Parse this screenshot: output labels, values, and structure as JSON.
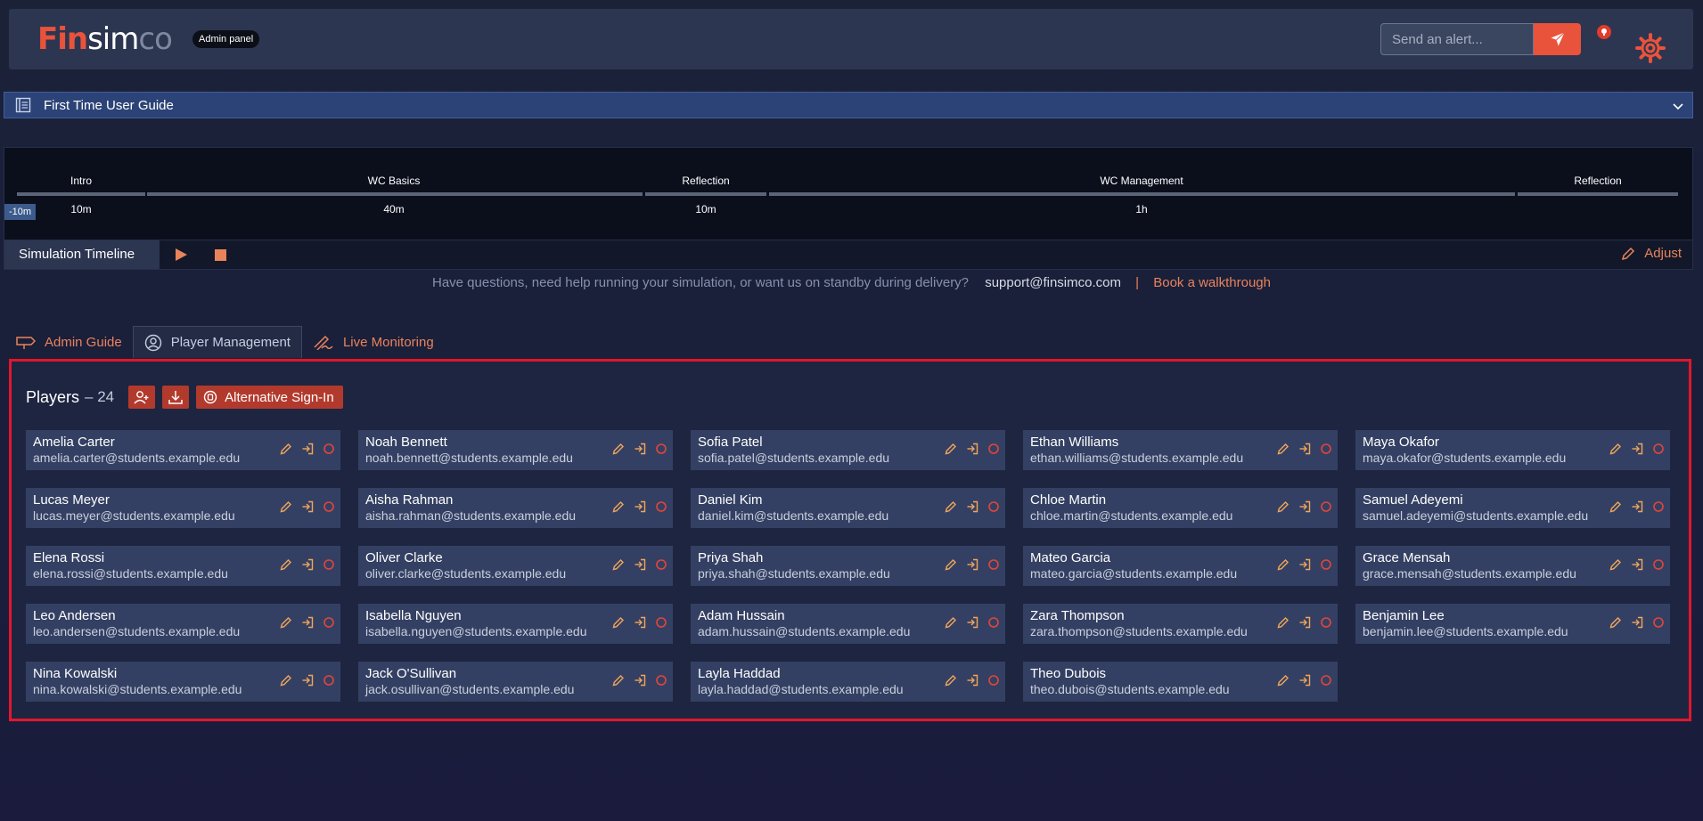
{
  "app": {
    "logo": {
      "fin": "Fin",
      "sim": "sim",
      "co": "co"
    },
    "badge": "Admin panel"
  },
  "alert": {
    "placeholder": "Send an alert..."
  },
  "guide": {
    "label": "First Time User Guide"
  },
  "timeline": {
    "offset": "-10m",
    "segments": [
      {
        "label": "Intro",
        "duration": "10m"
      },
      {
        "label": "WC Basics",
        "duration": "40m"
      },
      {
        "label": "Reflection",
        "duration": "10m"
      },
      {
        "label": "WC Management",
        "duration": "1h"
      },
      {
        "label": "Reflection",
        "duration": ""
      }
    ],
    "bar_label": "Simulation Timeline",
    "adjust_label": "Adjust"
  },
  "help": {
    "text": "Have questions, need help running your simulation, or want us on standby during delivery?",
    "email": "support@finsimco.com",
    "separator": "|",
    "walkthrough": "Book a walkthrough"
  },
  "tabs": [
    {
      "label": "Admin Guide",
      "icon": "signpost-icon",
      "active": false
    },
    {
      "label": "Player Management",
      "icon": "user-gear-icon",
      "active": true
    },
    {
      "label": "Live Monitoring",
      "icon": "signature-icon",
      "active": false
    }
  ],
  "players": {
    "title": "Players",
    "count": "– 24",
    "alt_signin": "Alternative Sign-In",
    "list": [
      {
        "name": "Amelia Carter",
        "email": "amelia.carter@students.example.edu"
      },
      {
        "name": "Noah Bennett",
        "email": "noah.bennett@students.example.edu"
      },
      {
        "name": "Sofia Patel",
        "email": "sofia.patel@students.example.edu"
      },
      {
        "name": "Ethan Williams",
        "email": "ethan.williams@students.example.edu"
      },
      {
        "name": "Maya Okafor",
        "email": "maya.okafor@students.example.edu"
      },
      {
        "name": "Lucas Meyer",
        "email": "lucas.meyer@students.example.edu"
      },
      {
        "name": "Aisha Rahman",
        "email": "aisha.rahman@students.example.edu"
      },
      {
        "name": "Daniel Kim",
        "email": "daniel.kim@students.example.edu"
      },
      {
        "name": "Chloe Martin",
        "email": "chloe.martin@students.example.edu"
      },
      {
        "name": "Samuel Adeyemi",
        "email": "samuel.adeyemi@students.example.edu"
      },
      {
        "name": "Elena Rossi",
        "email": "elena.rossi@students.example.edu"
      },
      {
        "name": "Oliver Clarke",
        "email": "oliver.clarke@students.example.edu"
      },
      {
        "name": "Priya Shah",
        "email": "priya.shah@students.example.edu"
      },
      {
        "name": "Mateo Garcia",
        "email": "mateo.garcia@students.example.edu"
      },
      {
        "name": "Grace Mensah",
        "email": "grace.mensah@students.example.edu"
      },
      {
        "name": "Leo Andersen",
        "email": "leo.andersen@students.example.edu"
      },
      {
        "name": "Isabella Nguyen",
        "email": "isabella.nguyen@students.example.edu"
      },
      {
        "name": "Adam Hussain",
        "email": "adam.hussain@students.example.edu"
      },
      {
        "name": "Zara Thompson",
        "email": "zara.thompson@students.example.edu"
      },
      {
        "name": "Benjamin Lee",
        "email": "benjamin.lee@students.example.edu"
      },
      {
        "name": "Nina Kowalski",
        "email": "nina.kowalski@students.example.edu"
      },
      {
        "name": "Jack O'Sullivan",
        "email": "jack.osullivan@students.example.edu"
      },
      {
        "name": "Layla Haddad",
        "email": "layla.haddad@students.example.edu"
      },
      {
        "name": "Theo Dubois",
        "email": "theo.dubois@students.example.edu"
      }
    ]
  },
  "colors": {
    "accent": "#e9533b",
    "accent_light": "#e9835b",
    "highlight_border": "#e3162b",
    "card_bg": "#344063"
  }
}
